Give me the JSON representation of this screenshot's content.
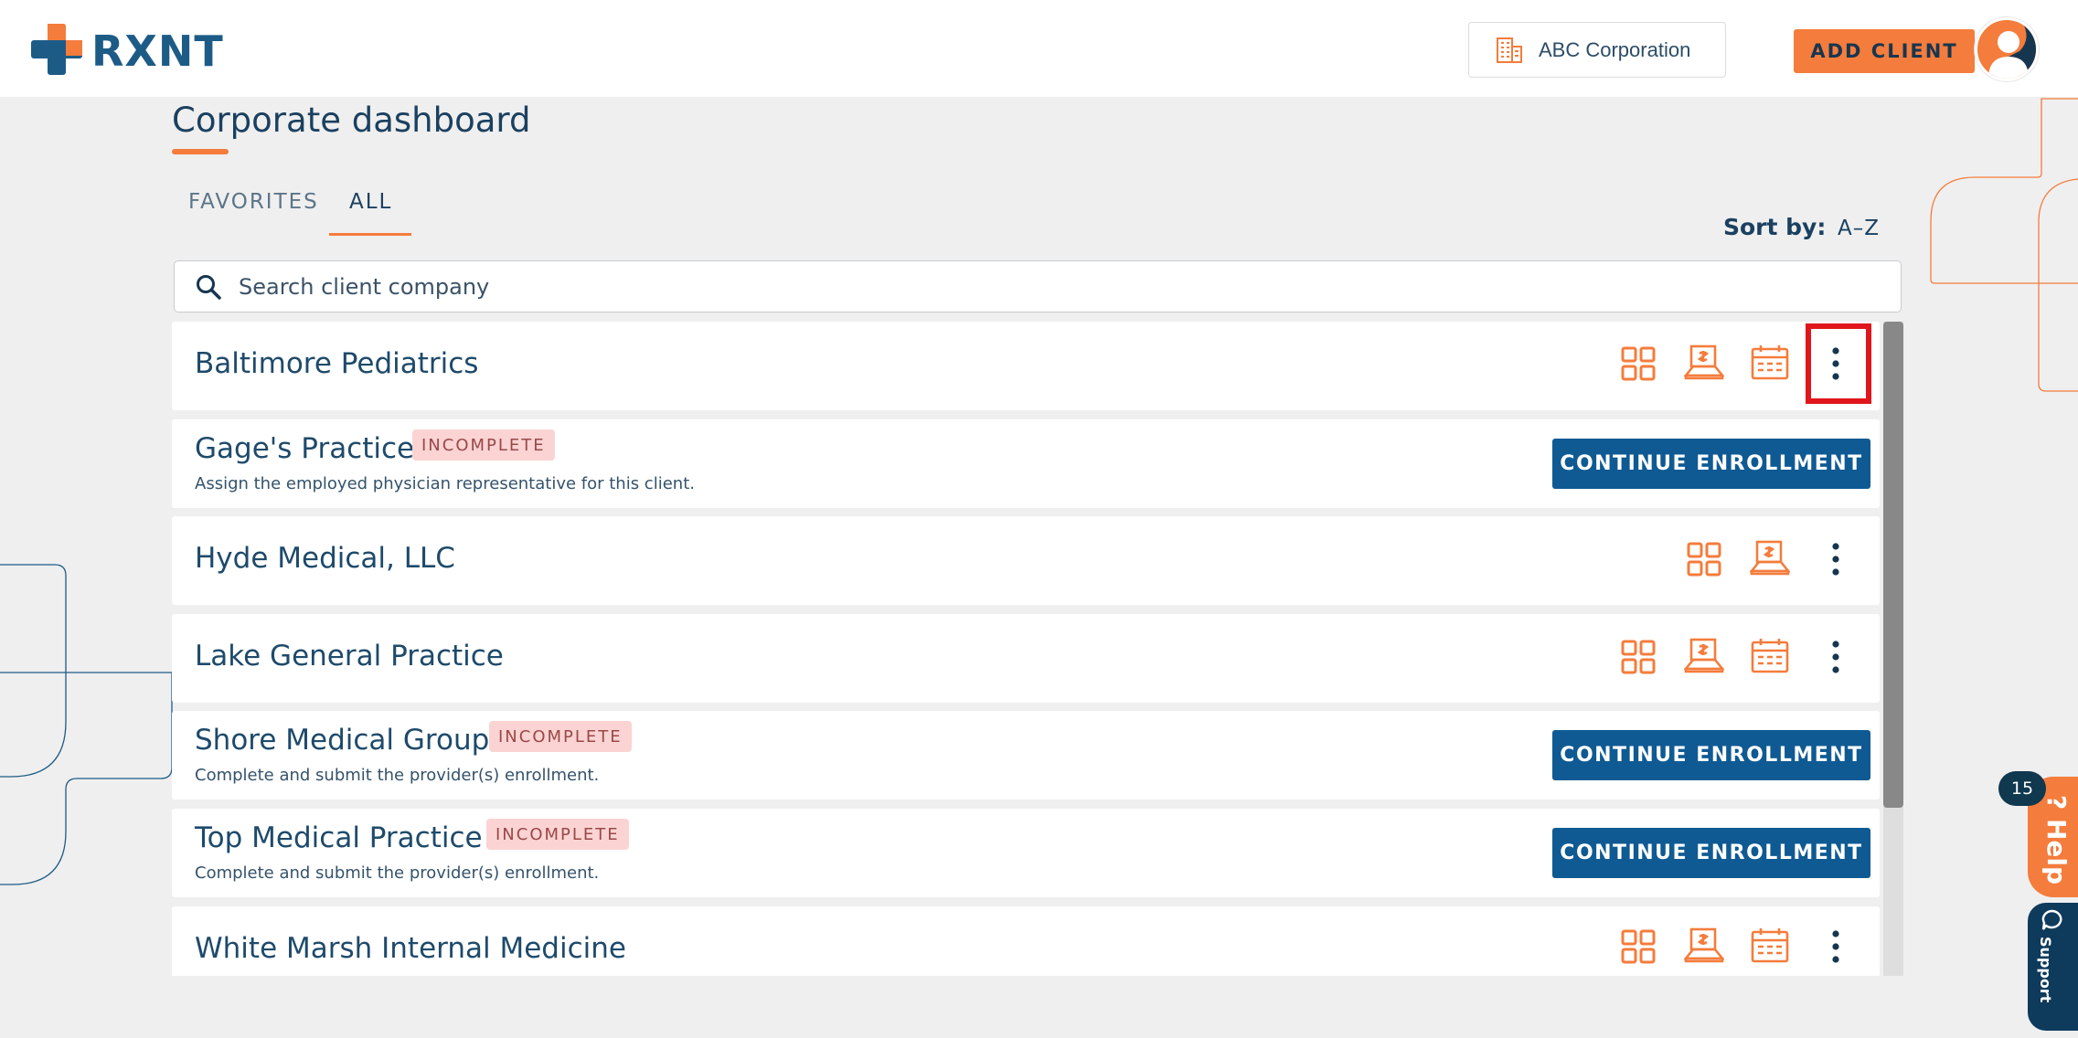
{
  "header": {
    "logo_text": "RXNT",
    "corporation": "ABC Corporation",
    "add_client_label": "ADD CLIENT"
  },
  "page": {
    "title": "Corporate dashboard",
    "tabs": [
      {
        "label": "FAVORITES",
        "active": false
      },
      {
        "label": "ALL",
        "active": true
      }
    ],
    "sort_label": "Sort by:",
    "sort_value": "A–Z",
    "search_placeholder": "Search client company"
  },
  "clients": [
    {
      "name": "Baltimore Pediatrics",
      "status": "",
      "description": "",
      "icons": [
        "dashboard-icon",
        "billing-icon",
        "scheduler-icon"
      ]
    },
    {
      "name": "Gage's Practice",
      "status": "INCOMPLETE",
      "description": "Assign the employed physician representative for this client.",
      "action": "CONTINUE ENROLLMENT"
    },
    {
      "name": "Hyde Medical, LLC",
      "status": "",
      "description": "",
      "icons": [
        "dashboard-icon",
        "billing-icon"
      ]
    },
    {
      "name": "Lake General Practice",
      "status": "",
      "description": "",
      "icons": [
        "dashboard-icon",
        "billing-icon",
        "scheduler-icon"
      ]
    },
    {
      "name": "Shore Medical Group",
      "status": "INCOMPLETE",
      "description": "Complete and submit the provider(s) enrollment.",
      "action": "CONTINUE ENROLLMENT"
    },
    {
      "name": "Top Medical Practice",
      "status": "INCOMPLETE",
      "description": "Complete and submit the provider(s) enrollment.",
      "action": "CONTINUE ENROLLMENT"
    },
    {
      "name": "White Marsh Internal Medicine",
      "status": "",
      "description": "",
      "icons": [
        "dashboard-icon",
        "billing-icon",
        "scheduler-icon"
      ]
    }
  ],
  "widgets": {
    "help_label": "? Help",
    "help_count": "15",
    "support_label": "Support"
  },
  "colors": {
    "accent": "#f47c3c",
    "primary": "#0f5a93",
    "text": "#1e4a6b",
    "badge_bg": "#fbd3d3",
    "highlight": "#e0161c"
  }
}
